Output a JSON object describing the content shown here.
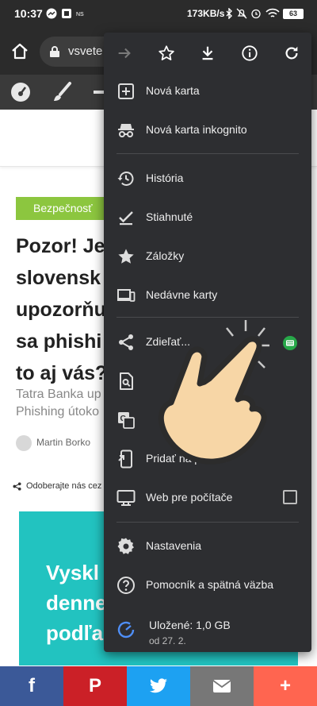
{
  "status_bar": {
    "time": "10:37",
    "speed": "173KB/s",
    "battery": "63",
    "left_icons": [
      "messenger-icon",
      "screen-record-icon",
      "ns-icon"
    ],
    "right_icons": [
      "bluetooth-icon",
      "mute-icon",
      "alarm-icon",
      "wifi-icon",
      "battery-icon"
    ]
  },
  "browser": {
    "url": "vsvete",
    "icons": [
      "home-icon",
      "lock-icon"
    ]
  },
  "menu": {
    "top_icons": [
      "forward-arrow-icon",
      "star-icon",
      "download-icon",
      "info-icon",
      "reload-icon"
    ],
    "items": [
      {
        "label": "Nová karta",
        "icon": "new-tab-icon"
      },
      {
        "label": "Nová karta inkognito",
        "icon": "incognito-icon"
      },
      {
        "label": "História",
        "icon": "history-icon"
      },
      {
        "label": "Stiahnuté",
        "icon": "downloads-check-icon"
      },
      {
        "label": "Záložky",
        "icon": "bookmark-star-icon"
      },
      {
        "label": "Nedávne karty",
        "icon": "recent-tabs-icon"
      },
      {
        "label": "Zdieľať...",
        "icon": "share-icon"
      },
      {
        "label": "",
        "icon": "find-in-page-icon"
      },
      {
        "label": "",
        "icon": "translate-icon"
      },
      {
        "label": "Pridať na plochu",
        "icon": "add-to-home-icon"
      },
      {
        "label": "Web pre počítače",
        "icon": "desktop-site-icon"
      },
      {
        "label": "Nastavenia",
        "icon": "settings-gear-icon"
      },
      {
        "label": "Pomocník a spätná väzba",
        "icon": "help-icon"
      }
    ],
    "storage": {
      "label": "Uložené: 1,0 GB",
      "sub": "od 27. 2."
    },
    "desktop_site_checked": false
  },
  "article": {
    "tag": "Bezpečnosť",
    "headline_lines": [
      "Pozor! Je",
      "slovensk",
      "upozorňu",
      "sa phishi",
      "to aj vás?"
    ],
    "excerpt_lines": [
      "Tatra Banka up",
      "Phishing útoko"
    ],
    "author": "Martin Borko",
    "subscribe": "Odoberajte nás cez",
    "banner_lines": [
      "Vyskl",
      "denne",
      "podľa"
    ]
  },
  "share_bar": [
    {
      "label": "f",
      "color": "#3b5998",
      "icon": "facebook-icon"
    },
    {
      "label": "P",
      "color": "#cb2027",
      "icon": "pinterest-icon"
    },
    {
      "label": "",
      "color": "#1da1f2",
      "icon": "twitter-icon"
    },
    {
      "label": "",
      "color": "#777777",
      "icon": "email-icon"
    },
    {
      "label": "+",
      "color": "#ff6550",
      "icon": "more-share-icon"
    }
  ]
}
